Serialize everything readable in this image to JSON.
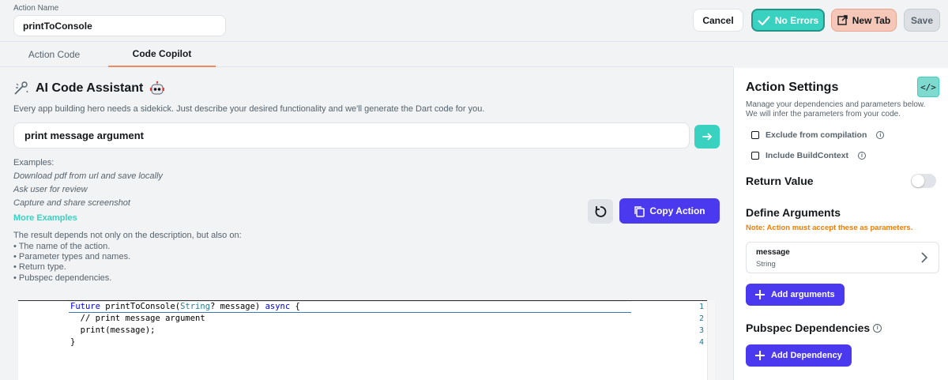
{
  "header": {
    "action_name_label": "Action Name",
    "action_name_value": "printToConsole",
    "cancel_label": "Cancel",
    "no_errors_label": "No Errors",
    "new_tab_label": "New Tab",
    "save_label": "Save"
  },
  "tabs": [
    {
      "label": "Action Code",
      "active": false
    },
    {
      "label": "Code Copilot",
      "active": true
    }
  ],
  "assistant": {
    "title": "AI Code Assistant",
    "description": "Every app building hero needs a sidekick. Just describe your desired functionality and we'll generate the Dart code for you.",
    "prompt_value": "print message argument",
    "examples_label": "Examples:",
    "examples": [
      "Download pdf from url and save locally",
      "Ask user for review",
      "Capture and share screenshot"
    ],
    "more_examples_label": "More Examples",
    "note_heading": "The result depends not only on the description, but also on:",
    "note_items": [
      "• The name of the action.",
      "• Parameter types and names.",
      "• Return type.",
      "• Pubspec dependencies."
    ],
    "copy_action_label": "Copy Action"
  },
  "editor": {
    "line_numbers": [
      "1",
      "2",
      "3",
      "4"
    ],
    "lines": {
      "l1_kw1": "Future",
      "l1_a": " printToConsole(",
      "l1_ty": "String",
      "l1_b": "? message) ",
      "l1_kw2": "async",
      "l1_c": " {",
      "l2_cm": "  // print message argument",
      "l3": "  print(message);",
      "l4": "}"
    }
  },
  "settings": {
    "title": "Action Settings",
    "description": "Manage your dependencies and parameters below. We will infer the parameters from your code.",
    "exclude_label": "Exclude from compilation",
    "exclude_checked": false,
    "include_context_label": "Include BuildContext",
    "include_context_checked": false,
    "return_value_label": "Return Value",
    "return_value_enabled": false,
    "define_args_label": "Define Arguments",
    "args_warning": "Note: Action must accept these as parameters.",
    "arguments": [
      {
        "name": "message",
        "type": "String"
      }
    ],
    "add_arguments_label": "Add arguments",
    "pubspec_label": "Pubspec Dependencies",
    "add_dependency_label": "Add Dependency",
    "code_toggle_glyph": "</>"
  },
  "colors": {
    "primary": "#4b39ef",
    "secondary": "#39d2c0",
    "warning": "#f57c00",
    "tab_accent": "#ee8b60"
  }
}
